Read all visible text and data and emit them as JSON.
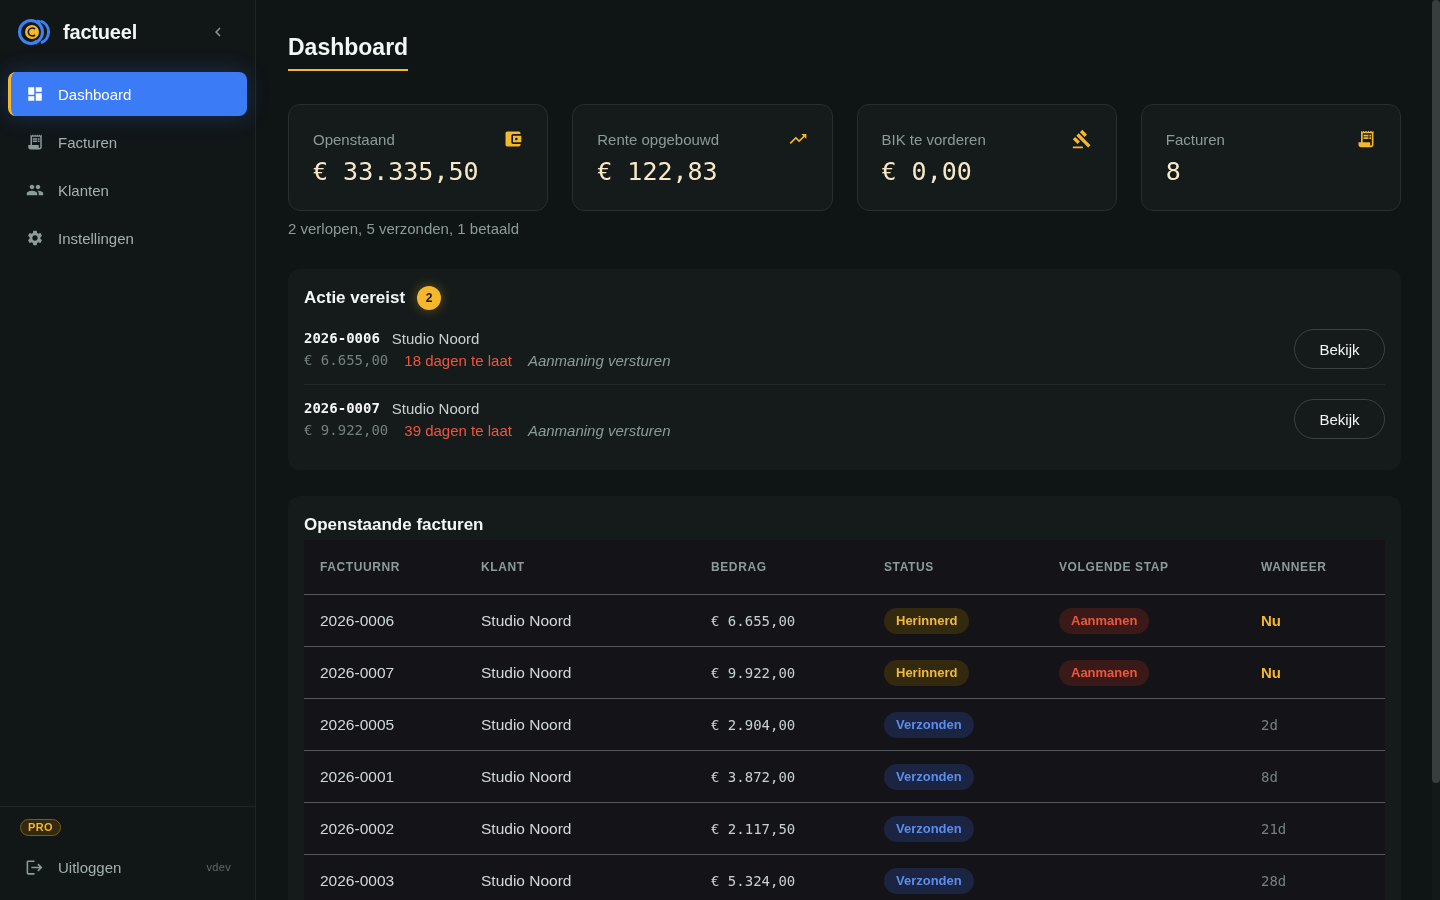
{
  "sidebar": {
    "brand": "factueel",
    "nav": [
      {
        "label": "Dashboard",
        "selected": true
      },
      {
        "label": "Facturen",
        "selected": false
      },
      {
        "label": "Klanten",
        "selected": false
      },
      {
        "label": "Instellingen",
        "selected": false
      }
    ],
    "plan_badge": "PRO",
    "logout": "Uitloggen",
    "version": "vdev"
  },
  "page": {
    "title": "Dashboard"
  },
  "stats": [
    {
      "label": "Openstaand",
      "value": "€ 33.335,50"
    },
    {
      "label": "Rente opgebouwd",
      "value": "€ 122,83"
    },
    {
      "label": "BIK te vorderen",
      "value": "€ 0,00"
    },
    {
      "label": "Facturen",
      "value": "8"
    }
  ],
  "summary": "2 verlopen, 5 verzonden, 1 betaald",
  "action_required": {
    "title": "Actie vereist",
    "count": "2",
    "items": [
      {
        "number": "2026-0006",
        "client": "Studio Noord",
        "amount": "€ 6.655,00",
        "overdue": "18 dagen te laat",
        "action": "Aanmaning versturen",
        "button": "Bekijk"
      },
      {
        "number": "2026-0007",
        "client": "Studio Noord",
        "amount": "€ 9.922,00",
        "overdue": "39 dagen te laat",
        "action": "Aanmaning versturen",
        "button": "Bekijk"
      }
    ]
  },
  "open_invoices": {
    "title": "Openstaande facturen",
    "columns": [
      "FACTUURNR",
      "KLANT",
      "BEDRAG",
      "STATUS",
      "VOLGENDE STAP",
      "WANNEER"
    ],
    "rows": [
      {
        "number": "2026-0006",
        "client": "Studio Noord",
        "amount": "€ 6.655,00",
        "status": {
          "label": "Herinnerd",
          "kind": "reminded"
        },
        "next_step": {
          "label": "Aanmanen",
          "kind": "dunning"
        },
        "when": {
          "label": "Nu",
          "urgent": true
        }
      },
      {
        "number": "2026-0007",
        "client": "Studio Noord",
        "amount": "€ 9.922,00",
        "status": {
          "label": "Herinnerd",
          "kind": "reminded"
        },
        "next_step": {
          "label": "Aanmanen",
          "kind": "dunning"
        },
        "when": {
          "label": "Nu",
          "urgent": true
        }
      },
      {
        "number": "2026-0005",
        "client": "Studio Noord",
        "amount": "€ 2.904,00",
        "status": {
          "label": "Verzonden",
          "kind": "sent"
        },
        "when": {
          "label": "2d",
          "urgent": false
        }
      },
      {
        "number": "2026-0001",
        "client": "Studio Noord",
        "amount": "€ 3.872,00",
        "status": {
          "label": "Verzonden",
          "kind": "sent"
        },
        "when": {
          "label": "8d",
          "urgent": false
        }
      },
      {
        "number": "2026-0002",
        "client": "Studio Noord",
        "amount": "€ 2.117,50",
        "status": {
          "label": "Verzonden",
          "kind": "sent"
        },
        "when": {
          "label": "21d",
          "urgent": false
        }
      },
      {
        "number": "2026-0003",
        "client": "Studio Noord",
        "amount": "€ 5.324,00",
        "status": {
          "label": "Verzonden",
          "kind": "sent"
        },
        "when": {
          "label": "28d",
          "urgent": false
        }
      }
    ]
  }
}
